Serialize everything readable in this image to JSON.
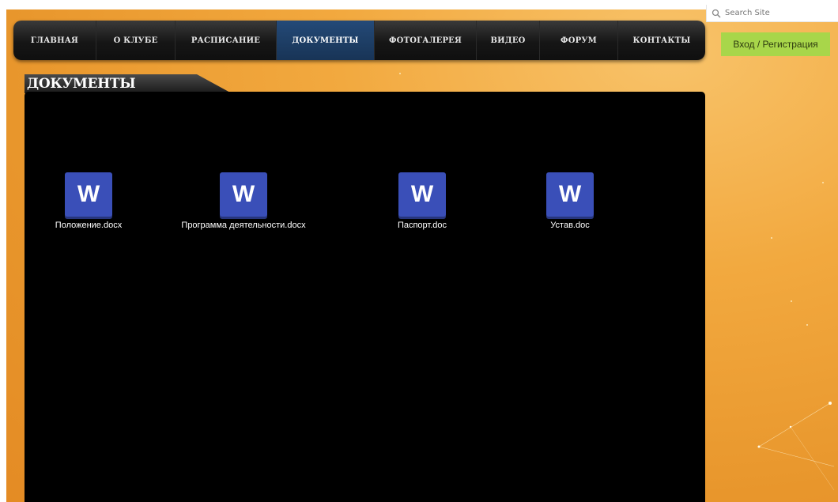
{
  "search": {
    "placeholder": "Search Site"
  },
  "auth": {
    "login_label": "Вход / Регистрация"
  },
  "nav": {
    "items": [
      {
        "label": "ГЛАВНАЯ"
      },
      {
        "label": "О КЛУБЕ"
      },
      {
        "label": "РАСПИСАНИЕ"
      },
      {
        "label": "ДОКУМЕНТЫ",
        "active": true
      },
      {
        "label": "ФОТОГАЛЕРЕЯ"
      },
      {
        "label": "ВИДЕО"
      },
      {
        "label": "ФОРУМ"
      },
      {
        "label": "КОНТАКТЫ"
      }
    ]
  },
  "page": {
    "title": "ДОКУМЕНТЫ"
  },
  "files": [
    {
      "icon": "word-doc-icon",
      "icon_letter": "W",
      "name": "Положение.docx"
    },
    {
      "icon": "word-doc-icon",
      "icon_letter": "W",
      "name": "Программа деятельности.docx"
    },
    {
      "icon": "word-doc-icon",
      "icon_letter": "W",
      "name": "Паспорт.doc"
    },
    {
      "icon": "word-doc-icon",
      "icon_letter": "W",
      "name": "Устав.doc"
    }
  ],
  "colors": {
    "accent": "#3a4fb8",
    "login": "#a8d64a",
    "nav_active": "#244a78"
  }
}
